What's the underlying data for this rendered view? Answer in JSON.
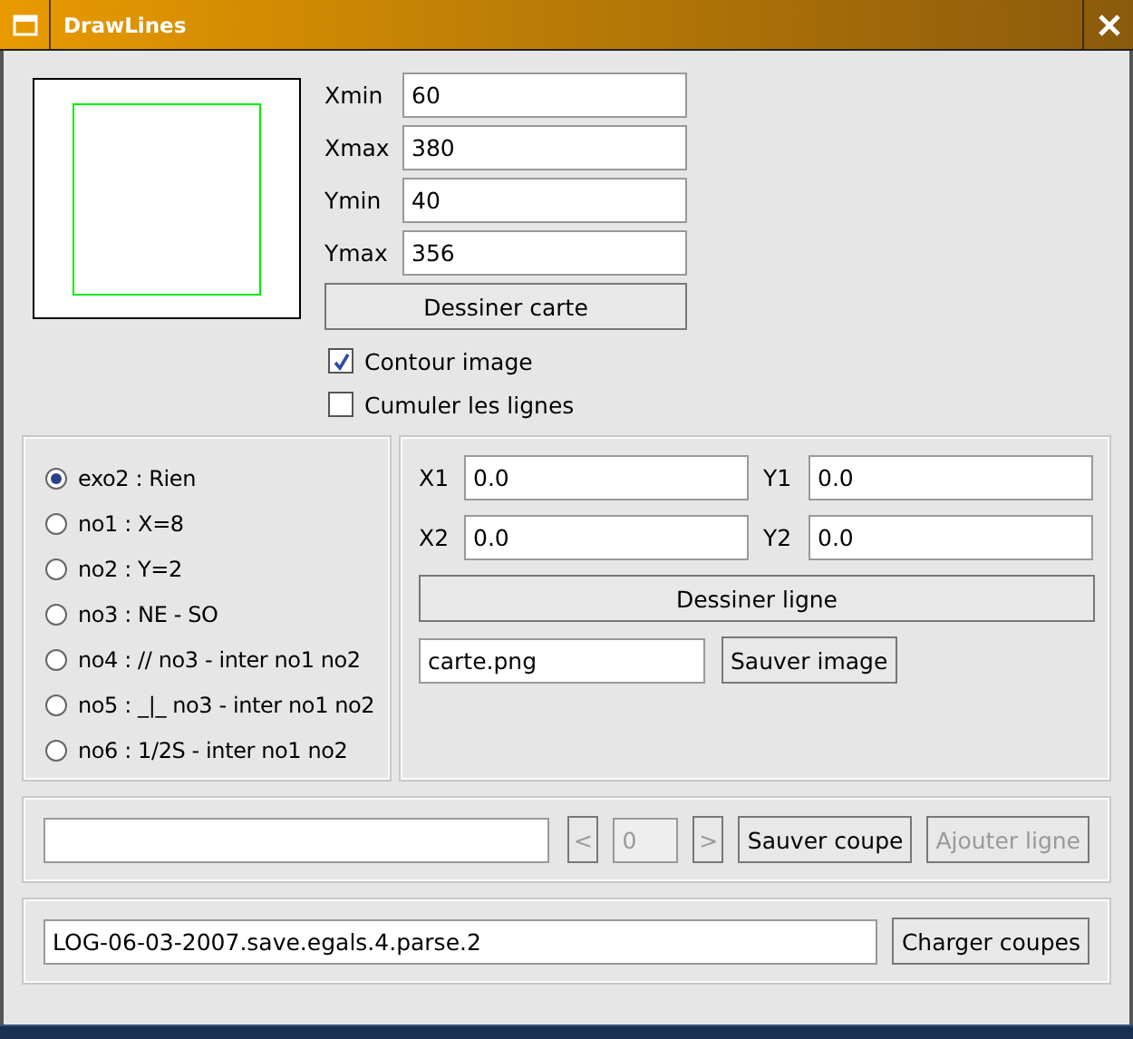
{
  "window": {
    "title": "DrawLines"
  },
  "bounds": [
    {
      "label": "Xmin",
      "value": "60"
    },
    {
      "label": "Xmax",
      "value": "380"
    },
    {
      "label": "Ymin",
      "value": "40"
    },
    {
      "label": "Ymax",
      "value": "356"
    }
  ],
  "draw_map_button": "Dessiner carte",
  "options": [
    {
      "label": "Contour image",
      "checked": true
    },
    {
      "label": "Cumuler les lignes",
      "checked": false
    }
  ],
  "modes": [
    {
      "label": "exo2 : Rien",
      "selected": true
    },
    {
      "label": "no1 : X=8",
      "selected": false
    },
    {
      "label": "no2 : Y=2",
      "selected": false
    },
    {
      "label": "no3 : NE - SO",
      "selected": false
    },
    {
      "label": "no4 : // no3 - inter no1 no2",
      "selected": false
    },
    {
      "label": "no5 : _|_ no3 - inter no1 no2",
      "selected": false
    },
    {
      "label": "no6 : 1/2S - inter no1 no2",
      "selected": false
    }
  ],
  "coords": [
    {
      "label": "X1",
      "value": "0.0"
    },
    {
      "label": "Y1",
      "value": "0.0"
    },
    {
      "label": "X2",
      "value": "0.0"
    },
    {
      "label": "Y2",
      "value": "0.0"
    }
  ],
  "draw_line_button": "Dessiner ligne",
  "image_file": {
    "value": "carte.png"
  },
  "save_image_button": "Sauver image",
  "cut_bar": {
    "prev": {
      "label": "<",
      "disabled": true
    },
    "index": {
      "value": "0",
      "disabled": true
    },
    "next": {
      "label": ">",
      "disabled": true
    },
    "save": {
      "label": "Sauver coupe",
      "disabled": false
    },
    "add": {
      "label": "Ajouter ligne",
      "disabled": true
    }
  },
  "load_bar": {
    "value": "LOG-06-03-2007.save.egals.4.parse.2",
    "button": "Charger coupes"
  }
}
